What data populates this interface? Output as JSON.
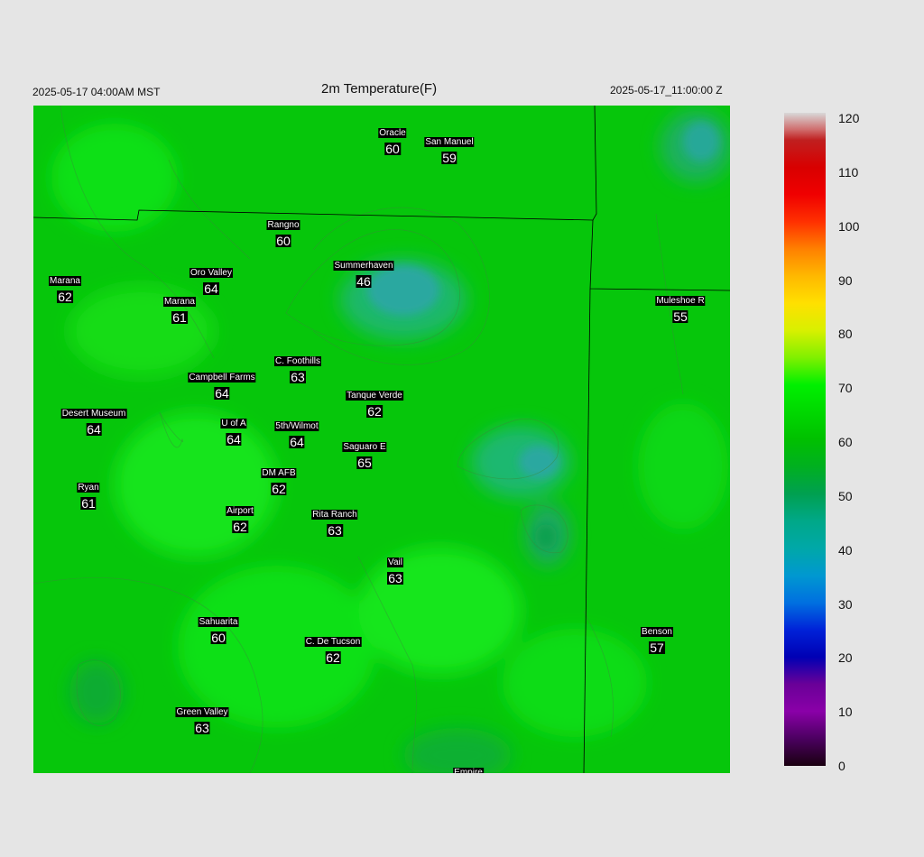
{
  "header": {
    "valid_local": "2025-05-17 04:00AM MST",
    "title": "2m Temperature(F)",
    "valid_utc": "2025-05-17_11:00:00 Z"
  },
  "stations": [
    {
      "name": "Oracle",
      "temp": "60"
    },
    {
      "name": "San Manuel",
      "temp": "59"
    },
    {
      "name": "Rangno",
      "temp": "60"
    },
    {
      "name": "Summerhaven",
      "temp": "46"
    },
    {
      "name": "Marana",
      "temp": "62"
    },
    {
      "name": "Oro Valley",
      "temp": "64"
    },
    {
      "name": "Marana",
      "temp": "61"
    },
    {
      "name": "Muleshoe R",
      "temp": "55"
    },
    {
      "name": "C. Foothills",
      "temp": "63"
    },
    {
      "name": "Campbell Farms",
      "temp": "64"
    },
    {
      "name": "Tanque Verde",
      "temp": "62"
    },
    {
      "name": "Desert Museum",
      "temp": "64"
    },
    {
      "name": "U of A",
      "temp": "64"
    },
    {
      "name": "5th/Wilmot",
      "temp": "64"
    },
    {
      "name": "Saguaro E",
      "temp": "65"
    },
    {
      "name": "DM AFB",
      "temp": "62"
    },
    {
      "name": "Ryan",
      "temp": "61"
    },
    {
      "name": "Airport",
      "temp": "62"
    },
    {
      "name": "Rita Ranch",
      "temp": "63"
    },
    {
      "name": "Vail",
      "temp": "63"
    },
    {
      "name": "Sahuarita",
      "temp": "60"
    },
    {
      "name": "C. De Tucson",
      "temp": "62"
    },
    {
      "name": "Benson",
      "temp": "57"
    },
    {
      "name": "Green Valley",
      "temp": "63"
    },
    {
      "name": "Empire",
      "temp": ""
    }
  ],
  "colorbar": {
    "labels": [
      "120",
      "110",
      "100",
      "90",
      "80",
      "70",
      "60",
      "50",
      "40",
      "30",
      "20",
      "10",
      "0"
    ],
    "range": [
      0,
      120
    ],
    "stops": [
      {
        "v": 0,
        "c": "#1a0010"
      },
      {
        "v": 5,
        "c": "#4b0060"
      },
      {
        "v": 10,
        "c": "#8a00a8"
      },
      {
        "v": 15,
        "c": "#6a0098"
      },
      {
        "v": 20,
        "c": "#0000b4"
      },
      {
        "v": 25,
        "c": "#0022d8"
      },
      {
        "v": 30,
        "c": "#0070e0"
      },
      {
        "v": 35,
        "c": "#0098d0"
      },
      {
        "v": 40,
        "c": "#00a8a8"
      },
      {
        "v": 45,
        "c": "#00a888"
      },
      {
        "v": 50,
        "c": "#00a050"
      },
      {
        "v": 55,
        "c": "#00b020"
      },
      {
        "v": 60,
        "c": "#00c000"
      },
      {
        "v": 65,
        "c": "#00d800"
      },
      {
        "v": 70,
        "c": "#00f000"
      },
      {
        "v": 75,
        "c": "#80f000"
      },
      {
        "v": 80,
        "c": "#d8f000"
      },
      {
        "v": 85,
        "c": "#ffe000"
      },
      {
        "v": 90,
        "c": "#ffb800"
      },
      {
        "v": 95,
        "c": "#ff8000"
      },
      {
        "v": 100,
        "c": "#ff3000"
      },
      {
        "v": 105,
        "c": "#f00000"
      },
      {
        "v": 110,
        "c": "#d80000"
      },
      {
        "v": 115,
        "c": "#c02020"
      },
      {
        "v": 117,
        "c": "#d07070"
      },
      {
        "v": 120,
        "c": "#d8d8d8"
      }
    ]
  },
  "colors": {
    "map_base": "#06c60b",
    "cool_area": "#2aa59a",
    "warm_area": "#12e81a",
    "background": "#e5e5e5"
  }
}
